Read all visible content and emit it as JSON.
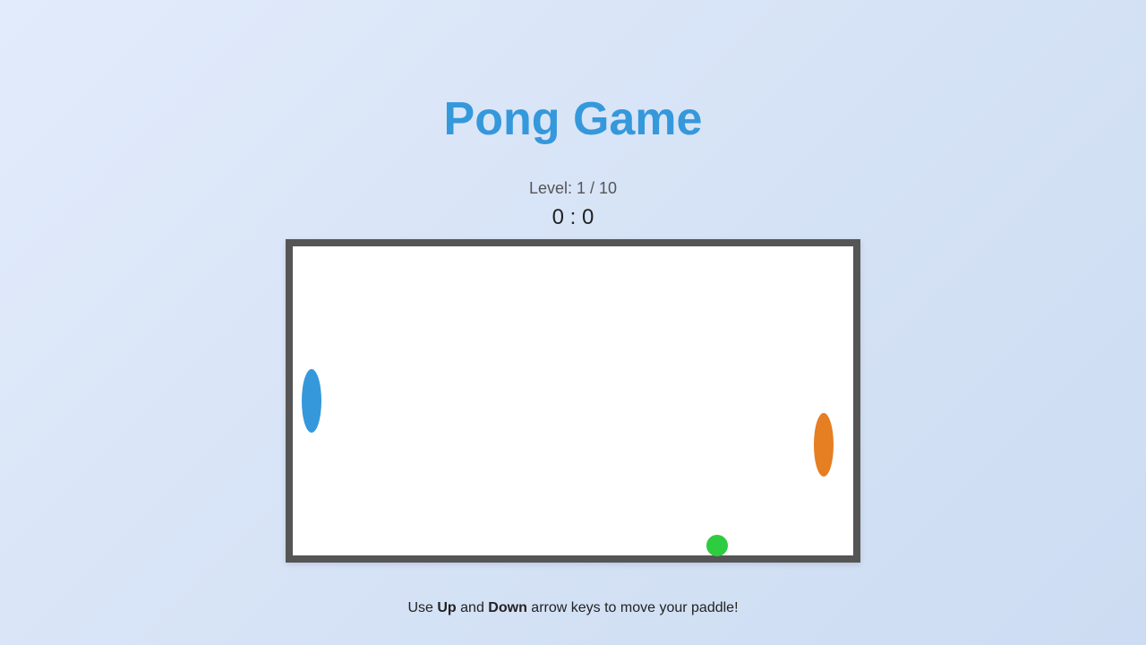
{
  "title": "Pong Game",
  "level": {
    "label": "Level: 1 / 10",
    "current": 1,
    "max": 10
  },
  "score": {
    "text": "0 : 0",
    "player": 0,
    "opponent": 0
  },
  "game": {
    "colors": {
      "player_paddle": "#3598db",
      "opponent_paddle": "#e67e22",
      "ball": "#2ecc40",
      "field": "#ffffff",
      "border": "#555555",
      "title": "#3598db"
    }
  },
  "instructions": {
    "prefix": "Use ",
    "key1": "Up",
    "mid": " and ",
    "key2": "Down",
    "suffix": " arrow keys to move your paddle!"
  }
}
